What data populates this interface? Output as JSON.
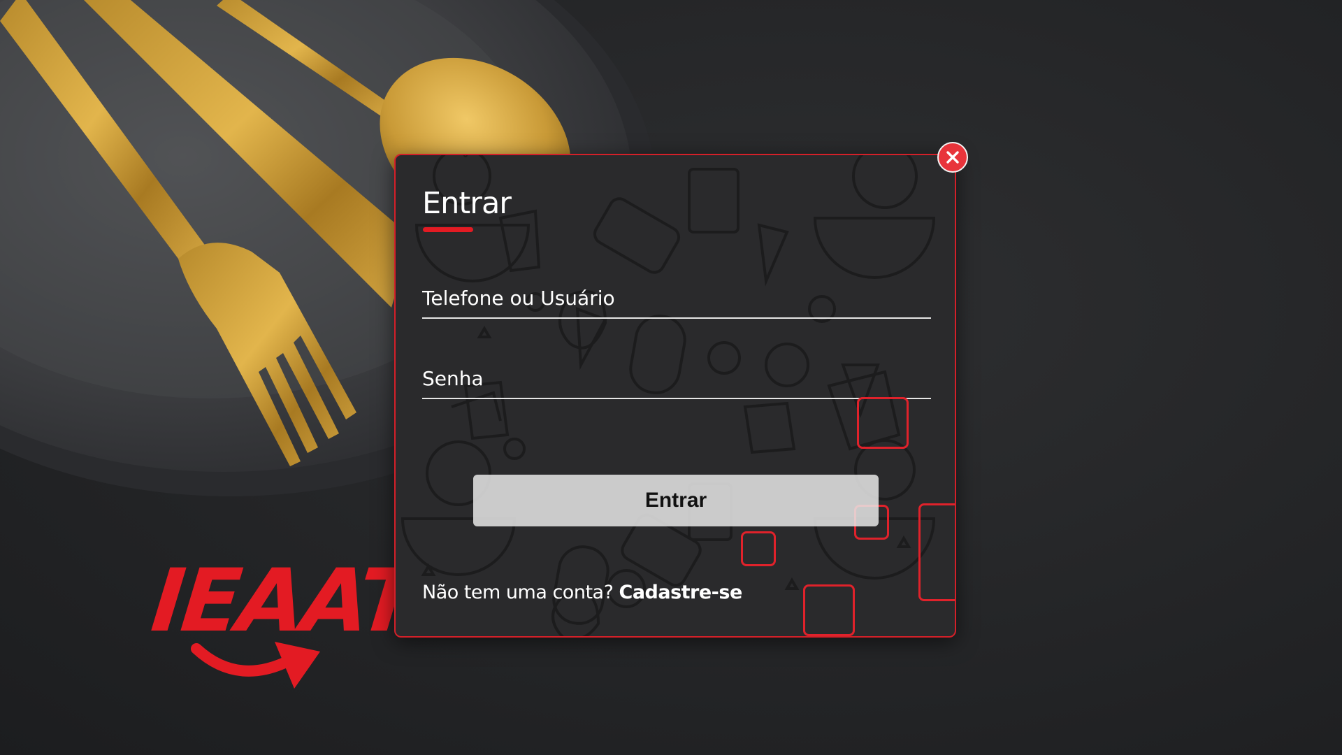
{
  "colors": {
    "accent": "#e31b23",
    "background": "#242527",
    "modal_background": "#2a2a2c",
    "button_background": "#e8e8e8",
    "text": "#ffffff"
  },
  "brand": {
    "logo_text": "IEAAT"
  },
  "login_modal": {
    "title": "Entrar",
    "close_icon": "close-icon",
    "fields": {
      "user": {
        "placeholder": "Telefone ou Usuário",
        "value": ""
      },
      "password": {
        "placeholder": "Senha",
        "value": ""
      }
    },
    "submit_label": "Entrar",
    "signup_prompt": "Não tem uma conta?",
    "signup_link": "Cadastre-se"
  }
}
